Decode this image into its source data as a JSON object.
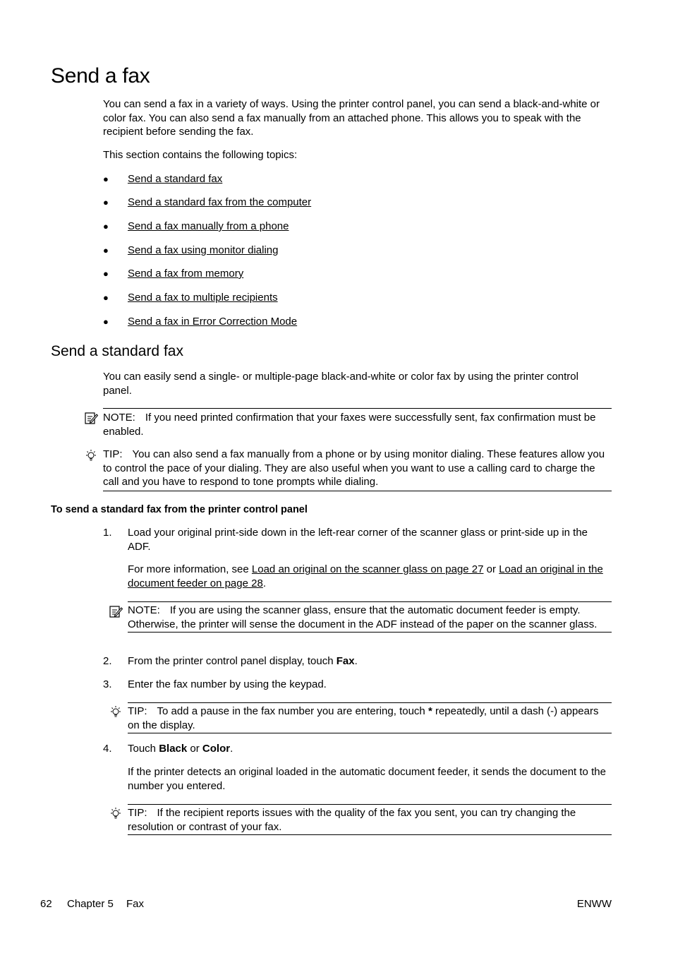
{
  "title": "Send a fax",
  "intro": "You can send a fax in a variety of ways. Using the printer control panel, you can send a black-and-white or color fax. You can also send a fax manually from an attached phone. This allows you to speak with the recipient before sending the fax.",
  "topics_intro": "This section contains the following topics:",
  "topics": [
    "Send a standard fax",
    "Send a standard fax from the computer",
    "Send a fax manually from a phone",
    "Send a fax using monitor dialing",
    "Send a fax from memory",
    "Send a fax to multiple recipients",
    "Send a fax in Error Correction Mode"
  ],
  "section": {
    "title": "Send a standard fax",
    "intro": "You can easily send a single- or multiple-page black-and-white or color fax by using the printer control panel.",
    "note1": {
      "label": "NOTE:",
      "text": "If you need printed confirmation that your faxes were successfully sent, fax confirmation must be enabled."
    },
    "tip1": {
      "label": "TIP:",
      "text": "You can also send a fax manually from a phone or by using monitor dialing. These features allow you to control the pace of your dialing. They are also useful when you want to use a calling card to charge the call and you have to respond to tone prompts while dialing."
    },
    "procedure_title": "To send a standard fax from the printer control panel",
    "steps": [
      {
        "num": "1.",
        "text": "Load your original print-side down in the left-rear corner of the scanner glass or print-side up in the ADF.",
        "more_prefix": "For more information, see ",
        "link1": "Load an original on the scanner glass on page 27",
        "more_mid": " or ",
        "link2": "Load an original in the document feeder on page 28",
        "more_suffix": ".",
        "note": {
          "label": "NOTE:",
          "text": "If you are using the scanner glass, ensure that the automatic document feeder is empty. Otherwise, the printer will sense the document in the ADF instead of the paper on the scanner glass."
        }
      },
      {
        "num": "2.",
        "text_prefix": "From the printer control panel display, touch ",
        "bold": "Fax",
        "text_suffix": "."
      },
      {
        "num": "3.",
        "text": "Enter the fax number by using the keypad.",
        "tip": {
          "label": "TIP:",
          "text_prefix": "To add a pause in the fax number you are entering, touch ",
          "bold": "*",
          "text_suffix": " repeatedly, until a dash (-) appears on the display."
        }
      },
      {
        "num": "4.",
        "text_prefix": "Touch ",
        "bold1": "Black",
        "text_mid": " or ",
        "bold2": "Color",
        "text_suffix": ".",
        "more": "If the printer detects an original loaded in the automatic document feeder, it sends the document to the number you entered.",
        "tip": {
          "label": "TIP:",
          "text": "If the recipient reports issues with the quality of the fax you sent, you can try changing the resolution or contrast of your fax."
        }
      }
    ]
  },
  "footer": {
    "page": "62",
    "chapter": "Chapter 5",
    "chapter_title": "Fax",
    "code": "ENWW"
  }
}
